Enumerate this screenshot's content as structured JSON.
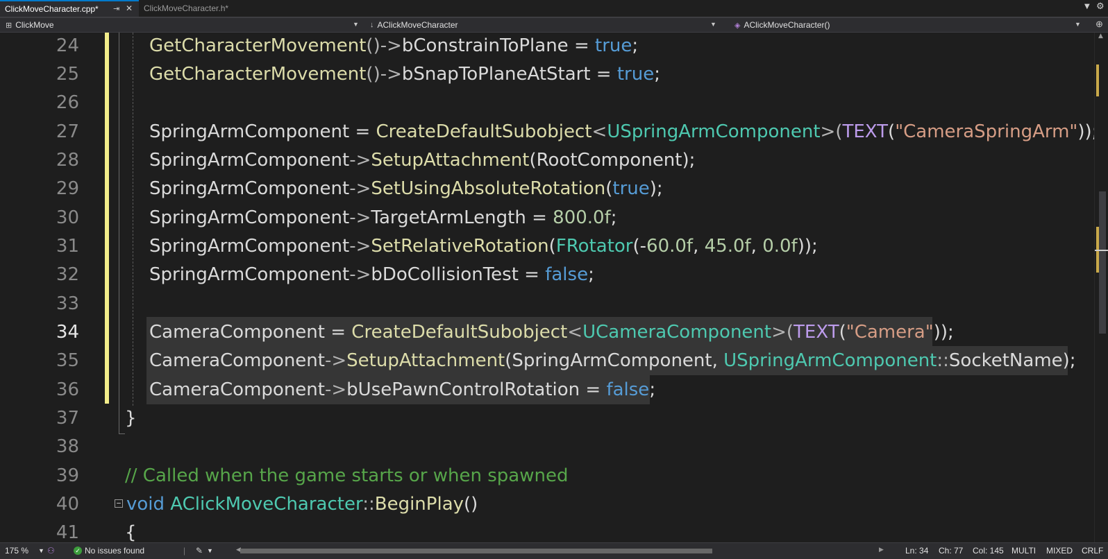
{
  "tabs": [
    {
      "label": "ClickMoveCharacter.cpp*",
      "active": true
    },
    {
      "label": "ClickMoveCharacter.h*",
      "active": false
    }
  ],
  "nav": {
    "project": "ClickMove",
    "scope": "AClickMoveCharacter",
    "member": "AClickMoveCharacter()"
  },
  "lines": {
    "l24": {
      "num": "24",
      "a": "GetCharacterMovement",
      "b": "()->",
      "c": "bConstrainToPlane = ",
      "d": "true",
      "e": ";"
    },
    "l25": {
      "num": "25",
      "a": "GetCharacterMovement",
      "b": "()->",
      "c": "bSnapToPlaneAtStart = ",
      "d": "true",
      "e": ";"
    },
    "l26": {
      "num": "26"
    },
    "l27": {
      "num": "27",
      "a": "SpringArmComponent = ",
      "b": "CreateDefaultSubobject",
      "c": "<",
      "d": "USpringArmComponent",
      "e": ">(",
      "f": "TEXT",
      "g": "(",
      "h": "\"CameraSpringArm\"",
      "i": "));"
    },
    "l28": {
      "num": "28",
      "a": "SpringArmComponent",
      "b": "->",
      "c": "SetupAttachment",
      "d": "(RootComponent);"
    },
    "l29": {
      "num": "29",
      "a": "SpringArmComponent",
      "b": "->",
      "c": "SetUsingAbsoluteRotation",
      "d": "(",
      "e": "true",
      "f": ");"
    },
    "l30": {
      "num": "30",
      "a": "SpringArmComponent",
      "b": "->",
      "c": "TargetArmLength = ",
      "d": "800.0f",
      "e": ";"
    },
    "l31": {
      "num": "31",
      "a": "SpringArmComponent",
      "b": "->",
      "c": "SetRelativeRotation",
      "d": "(",
      "e": "FRotator",
      "f": "(-",
      "g": "60.0f",
      "h": ", ",
      "i": "45.0f",
      "j": ", ",
      "k": "0.0f",
      "l": "));"
    },
    "l32": {
      "num": "32",
      "a": "SpringArmComponent",
      "b": "->",
      "c": "bDoCollisionTest = ",
      "d": "false",
      "e": ";"
    },
    "l33": {
      "num": "33"
    },
    "l34": {
      "num": "34",
      "a": "CameraComponent = ",
      "b": "CreateDefaultSubobject",
      "c": "<",
      "d": "UCameraComponent",
      "e": ">(",
      "f": "TEXT",
      "g": "(",
      "h": "\"Camera\"",
      "i": "));"
    },
    "l35": {
      "num": "35",
      "a": "CameraComponent",
      "b": "->",
      "c": "SetupAttachment",
      "d": "(SpringArmComponent, ",
      "e": "USpringArmComponent",
      "f": "::",
      "g": "SocketName);"
    },
    "l36": {
      "num": "36",
      "a": "CameraComponent",
      "b": "->",
      "c": "bUsePawnControlRotation = ",
      "d": "false",
      "e": ";"
    },
    "l37": {
      "num": "37",
      "a": "}"
    },
    "l38": {
      "num": "38"
    },
    "l39": {
      "num": "39",
      "a": "// Called when the game starts or when spawned"
    },
    "l40": {
      "num": "40",
      "a": "void",
      "b": " ",
      "c": "AClickMoveCharacter",
      "d": "::",
      "e": "BeginPlay",
      "f": "()"
    },
    "l41": {
      "num": "41",
      "a": "{"
    }
  },
  "status": {
    "zoom": "175 %",
    "issues": "No issues found",
    "ln": "Ln: 34",
    "ch": "Ch: 77",
    "col": "Col: 145",
    "multi": "MULTI",
    "mixed": "MIXED",
    "eol": "CRLF"
  },
  "colors": {
    "keyword": "#569cd6",
    "function": "#dcdcaa",
    "type": "#4ec9b0",
    "string": "#d69d85",
    "number": "#b5cea8",
    "macro": "#bd9cec",
    "comment": "#57a64a",
    "modified": "#f2ed8a"
  }
}
